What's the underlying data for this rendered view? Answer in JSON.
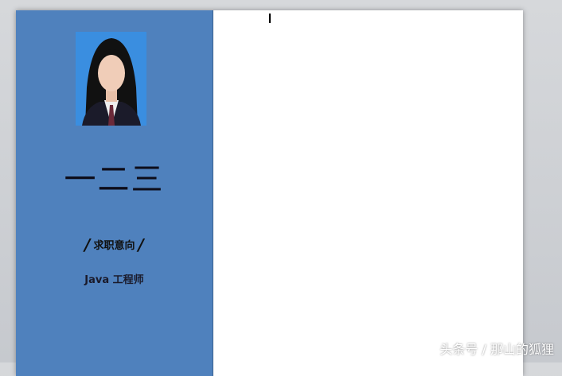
{
  "resume": {
    "name": "一二三",
    "job_intent_label": "求职意向",
    "slash": "/",
    "job_title": "Java 工程师"
  },
  "watermark": "头条号 / 那山的狐狸",
  "colors": {
    "sidebar": "#4f81bd",
    "photo_bg": "#3a8ee0"
  }
}
